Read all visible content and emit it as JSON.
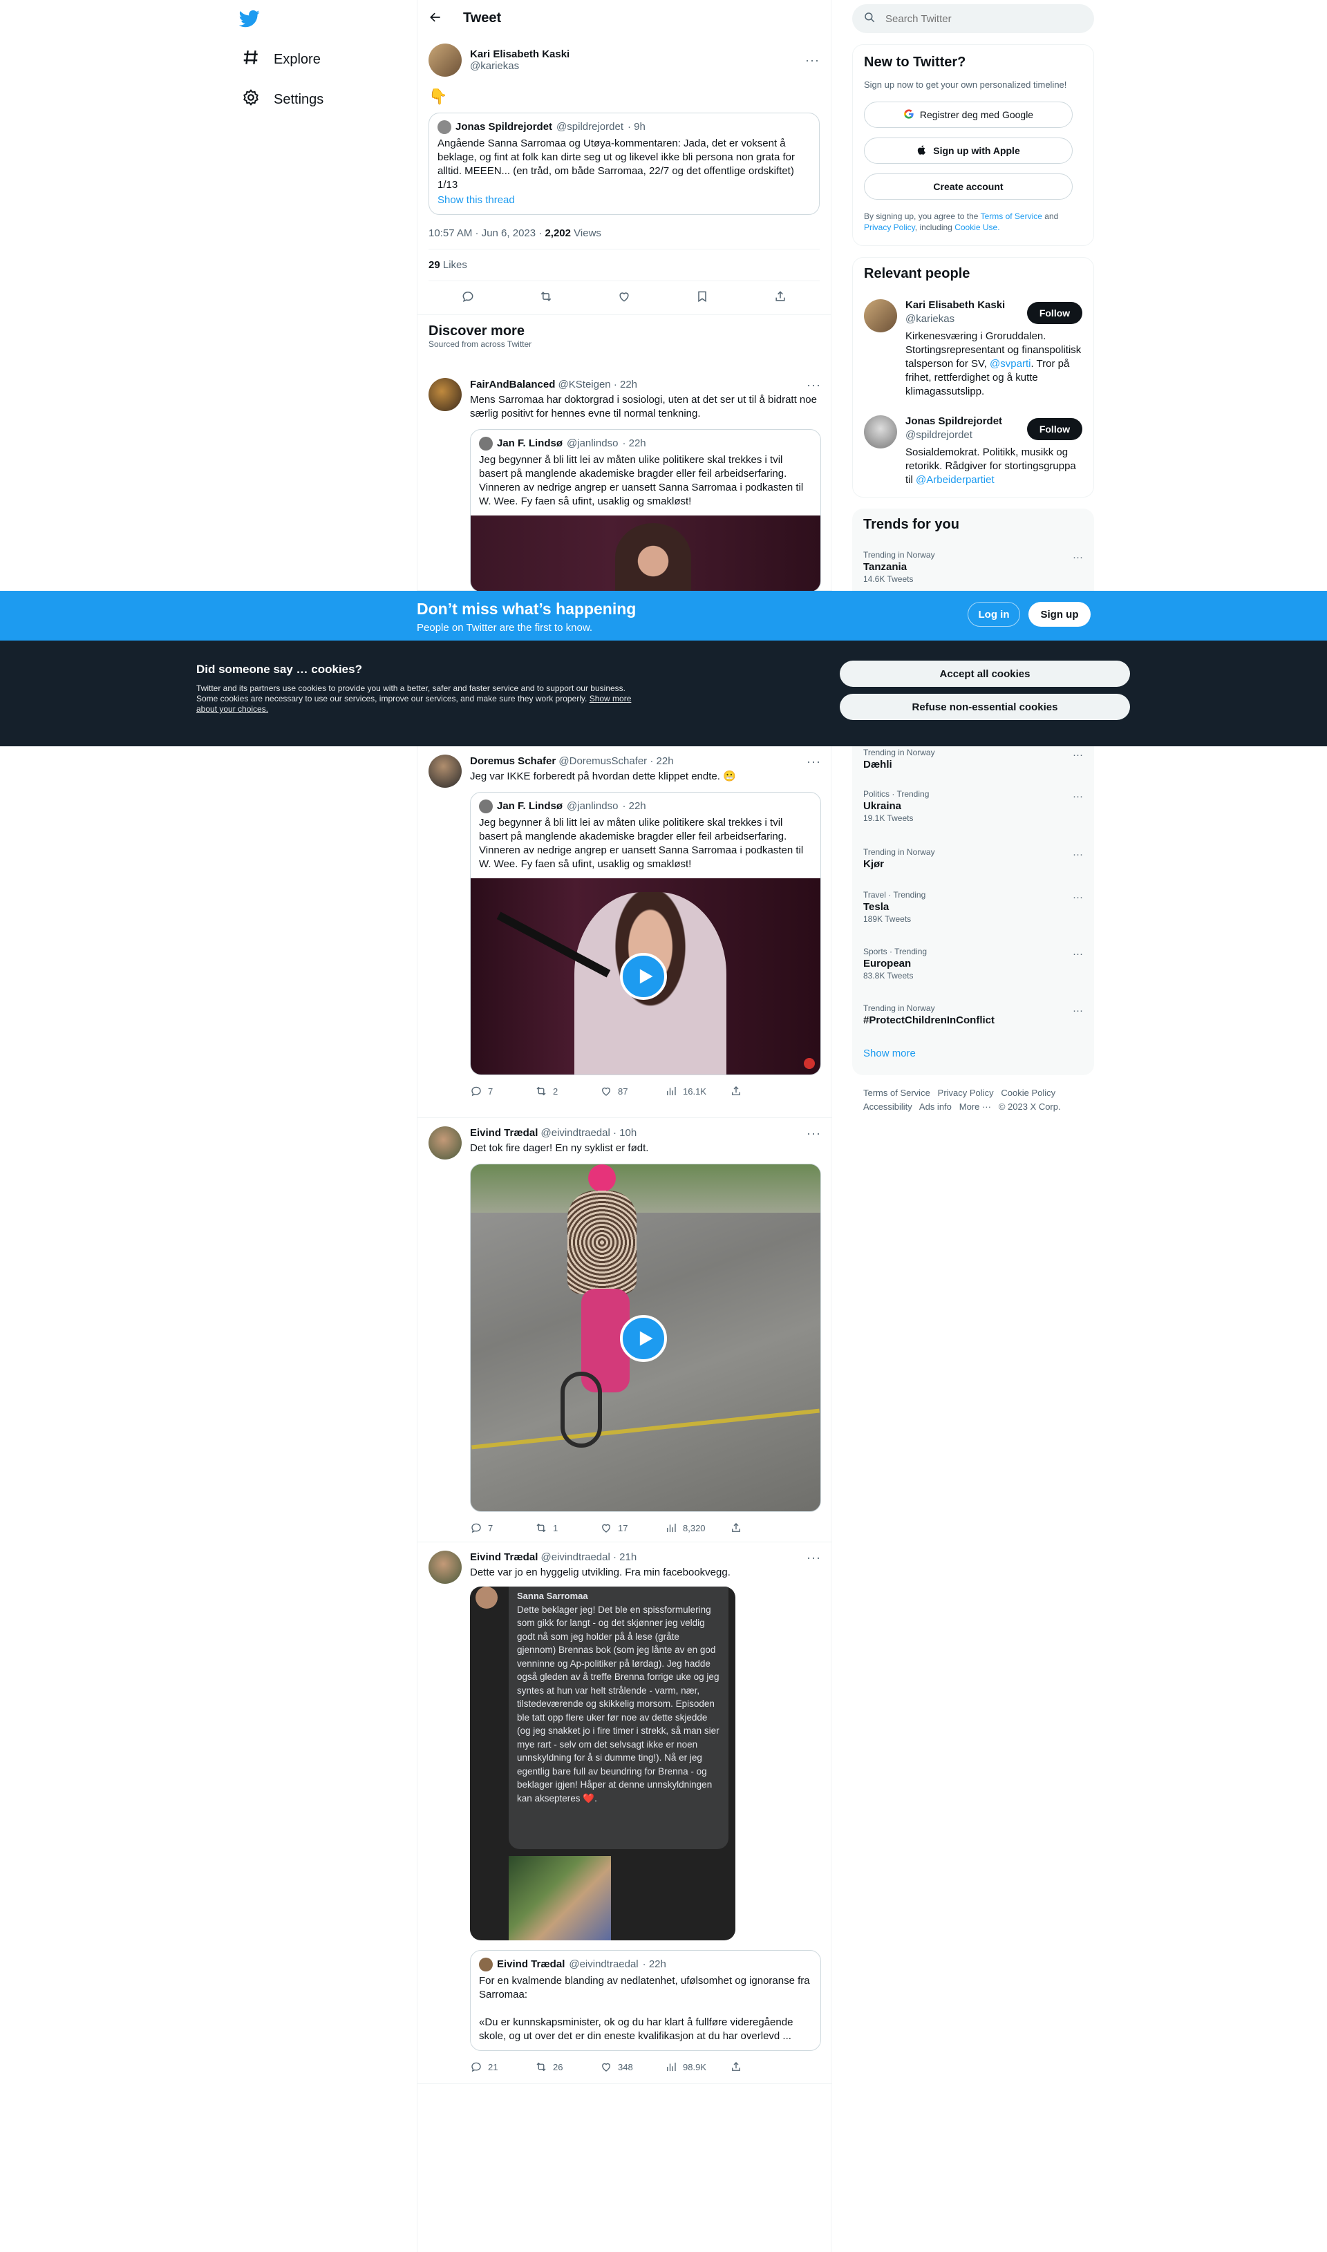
{
  "nav": {
    "items": [
      {
        "label": "Explore",
        "icon": "hashtag-icon"
      },
      {
        "label": "Settings",
        "icon": "gear-icon"
      }
    ]
  },
  "header": {
    "title": "Tweet"
  },
  "tweet": {
    "author_name": "Kari Elisabeth Kaski",
    "author_handle": "@kariekas",
    "emoji": "👇",
    "quote": {
      "author_name": "Jonas Spildrejordet",
      "author_handle": "@spildrejordet",
      "time": "· 9h",
      "text": "Angående Sanna Sarromaa og Utøya-kommentaren: Jada, det er voksent å beklage, og fint at folk kan dirte seg ut og likevel ikke bli persona non grata for alltid. MEEEN... (en tråd, om både Sarromaa, 22/7 og det offentlige ordskiftet) 1/13",
      "link": "Show this thread"
    },
    "time": "10:57 AM · Jun 6, 2023",
    "views_count": "2,202",
    "views_label": "Views",
    "likes_count": "29",
    "likes_label": "Likes"
  },
  "discover": {
    "title": "Discover more",
    "subtitle": "Sourced from across Twitter"
  },
  "posts": [
    {
      "name": "FairAndBalanced",
      "handle": "@KSteigen",
      "time": "· 22h",
      "text": "Mens Sarromaa har doktorgrad i sosiologi, uten at det ser ut til å bidratt noe særlig positivt for hennes evne til normal tenkning.",
      "quote": {
        "name": "Jan F. Lindsø",
        "handle": "@janlindso",
        "time": "· 22h",
        "text": "Jeg begynner å bli litt lei av måten ulike politikere skal trekkes i tvil basert på manglende akademiske bragder eller feil arbeidserfaring. Vinneren av nedrige angrep er uansett Sanna Sarromaa i podkasten til W. Wee. Fy faen så ufint, usaklig og smakløst!"
      }
    },
    {
      "name": "Doremus Schafer",
      "handle": "@DoremusSchafer",
      "time": "· 22h",
      "text": "Jeg var IKKE forberedt på hvordan dette klippet endte. 😬",
      "quote": {
        "name": "Jan F. Lindsø",
        "handle": "@janlindso",
        "time": "· 22h",
        "text": "Jeg begynner å bli litt lei av måten ulike politikere skal trekkes i tvil basert på manglende akademiske bragder eller feil arbeidserfaring. Vinneren av nedrige angrep er uansett Sanna Sarromaa i podkasten til W. Wee. Fy faen så ufint, usaklig og smakløst!"
      },
      "stats": {
        "replies": "7",
        "retweets": "2",
        "likes": "87",
        "views": "16.1K"
      }
    },
    {
      "name": "Eivind Trædal",
      "handle": "@eivindtraedal",
      "time": "· 10h",
      "text": "Det tok fire dager! En ny syklist er født.",
      "stats": {
        "replies": "7",
        "retweets": "1",
        "likes": "17",
        "views": "8,320"
      }
    },
    {
      "name": "Eivind Trædal",
      "handle": "@eivindtraedal",
      "time": "· 21h",
      "text": "Dette var jo en hyggelig utvikling. Fra min facebookvegg.",
      "screenshot": {
        "name": "Sanna Sarromaa",
        "text": "Dette beklager jeg! Det ble en spissformulering som gikk for langt - og det skjønner jeg veldig godt nå som jeg holder på å lese (gråte gjennom) Brennas bok (som jeg lånte av en god venninne og Ap-politiker på lørdag). Jeg hadde også gleden av å treffe Brenna forrige uke og jeg syntes at hun var helt strålende - varm, nær, tilstedeværende og skikkelig morsom. Episoden ble tatt opp flere uker før noe av dette skjedde (og jeg snakket jo i fire timer i strekk, så man sier mye rart - selv om det selvsagt ikke er noen unnskyldning for å si dumme ting!). Nå er jeg egentlig bare full av beundring for Brenna - og beklager igjen! Håper at denne unnskyldningen kan aksepteres ❤️."
      },
      "quote": {
        "name": "Eivind Trædal",
        "handle": "@eivindtraedal",
        "time": "· 22h",
        "text": "For en kvalmende blanding av nedlatenhet, ufølsomhet og ignoranse fra Sarromaa:",
        "text2": "«Du er kunnskapsminister, ok og du har klart å fullføre videregående skole, og ut over det er din eneste kvalifikasjon at du har overlevd ..."
      },
      "stats": {
        "replies": "21",
        "retweets": "26",
        "likes": "348",
        "views": "98.9K"
      }
    }
  ],
  "search": {
    "placeholder": "Search Twitter"
  },
  "new_to_twitter": {
    "title": "New to Twitter?",
    "subtitle": "Sign up now to get your own personalized timeline!",
    "google": "Registrer deg med Google",
    "apple": "Sign up with Apple",
    "create": "Create account",
    "terms_pre": "By signing up, you agree to the",
    "terms_link": "Terms of Service",
    "and": "and",
    "privacy_link": "Privacy Policy",
    "including": ", including",
    "cookie_link": "Cookie Use."
  },
  "relevant": {
    "title": "Relevant people",
    "people": [
      {
        "name": "Kari Elisabeth Kaski",
        "handle": "@kariekas",
        "bio_pre": "Kirkenesværing i Groruddalen. Stortingsrepresentant og finanspolitisk talsperson for SV,",
        "bio_link": "@svparti",
        "bio_post": ". Tror på frihet, rettferdighet og å kutte klimagassutslipp.",
        "follow": "Follow"
      },
      {
        "name": "Jonas Spildrejordet",
        "handle": "@spildrejordet",
        "bio_pre": "Sosialdemokrat. Politikk, musikk og retorikk. Rådgiver for stortingsgruppa til",
        "bio_link": "@Arbeiderpartiet",
        "bio_post": "",
        "follow": "Follow"
      }
    ]
  },
  "trends": {
    "title": "Trends for you",
    "items": [
      {
        "cat": "Trending in Norway",
        "name": "Tanzania",
        "count": "14.6K Tweets"
      },
      {
        "cat": "Trending in Norway",
        "name": "Dæhli",
        "count": ""
      },
      {
        "cat": "Politics · Trending",
        "name": "Ukraina",
        "count": "19.1K Tweets"
      },
      {
        "cat": "Trending in Norway",
        "name": "Kjør",
        "count": ""
      },
      {
        "cat": "Travel · Trending",
        "name": "Tesla",
        "count": "189K Tweets"
      },
      {
        "cat": "Sports · Trending",
        "name": "European",
        "count": "83.8K Tweets"
      },
      {
        "cat": "Trending in Norway",
        "name": "#ProtectChildrenInConflict",
        "count": ""
      }
    ],
    "show_more": "Show more"
  },
  "footer": {
    "links": [
      "Terms of Service",
      "Privacy Policy",
      "Cookie Policy",
      "Accessibility",
      "Ads info",
      "More ···",
      "© 2023 X Corp."
    ]
  },
  "banner": {
    "title": "Don’t miss what’s happening",
    "subtitle": "People on Twitter are the first to know.",
    "login": "Log in",
    "signup": "Sign up"
  },
  "cookie": {
    "title": "Did someone say … cookies?",
    "text": "Twitter and its partners use cookies to provide you with a better, safer and faster service and to support our business. Some cookies are necessary to use our services, improve our services, and make sure they work properly.",
    "link": "Show more about your choices.",
    "accept": "Accept all cookies",
    "refuse": "Refuse non-essential cookies"
  },
  "colors": {
    "accent": "#1d9bf0",
    "dark": "#0f1419",
    "cookie_bg": "#15202b"
  }
}
